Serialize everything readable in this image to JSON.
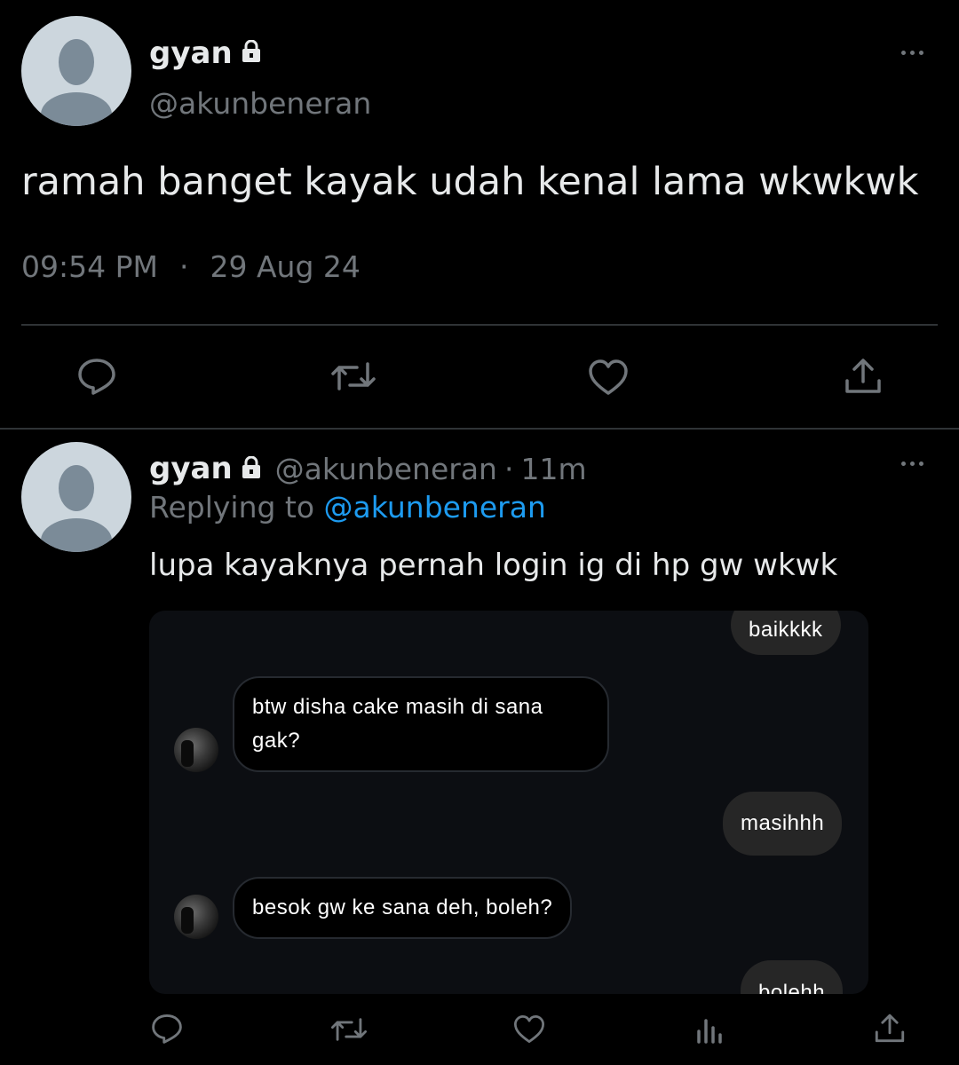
{
  "main_tweet": {
    "display_name": "gyan",
    "handle": "@akunbeneran",
    "text": "ramah banget kayak udah kenal lama wkwkwk",
    "time": "09:54 PM",
    "separator": "·",
    "date": "29 Aug 24",
    "icons": [
      "reply-icon",
      "retweet-icon",
      "like-icon",
      "share-icon",
      "more-icon",
      "lock-icon"
    ]
  },
  "reply_tweet": {
    "display_name": "gyan",
    "handle": "@akunbeneran",
    "separator": "·",
    "age": "11m",
    "replying_prefix": "Replying to",
    "replying_handle": "@akunbeneran",
    "text": "lupa kayaknya pernah login ig di hp gw wkwk",
    "icons": [
      "reply-icon",
      "retweet-icon",
      "like-icon",
      "views-icon",
      "share-icon",
      "more-icon",
      "lock-icon"
    ]
  },
  "chat_embed": {
    "messages": [
      {
        "side": "out",
        "text": "baikkkk"
      },
      {
        "side": "in",
        "text": "btw disha cake masih di sana gak?"
      },
      {
        "side": "out",
        "text": "masihhh"
      },
      {
        "side": "in",
        "text": "besok gw ke sana deh, boleh?"
      },
      {
        "side": "out",
        "text": "bolehh"
      }
    ]
  },
  "colors": {
    "background": "#000000",
    "text": "#e7e9ea",
    "muted": "#71767b",
    "link": "#1d9bf0",
    "divider": "#2f3336"
  }
}
